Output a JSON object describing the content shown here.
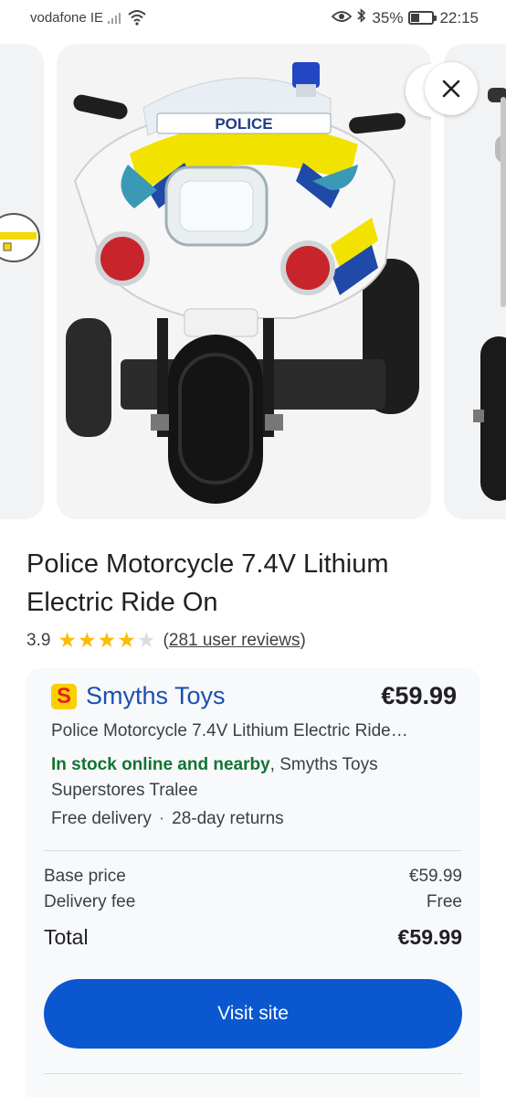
{
  "status_bar": {
    "carrier": "vodafone IE",
    "battery": "35%",
    "time": "22:15"
  },
  "carousel": {
    "main_image_text": "POLICE",
    "more_icon": "more-vert-icon",
    "close_icon": "close-icon"
  },
  "product": {
    "title": "Police Motorcycle 7.4V Lithium Electric Ride On",
    "rating": "3.9",
    "stars": 3.9,
    "reviews": "281 user reviews"
  },
  "seller": {
    "logo_letter": "S",
    "name": "Smyths Toys",
    "price": "€59.99",
    "listing_title": "Police Motorcycle 7.4V Lithium Electric Ride…",
    "stock_status": "In stock online and nearby",
    "stock_location": ", Smyths Toys Superstores Tralee",
    "delivery": "Free delivery",
    "returns": "28-day returns"
  },
  "price_breakdown": {
    "base_label": "Base price",
    "base_value": "€59.99",
    "delivery_label": "Delivery fee",
    "delivery_value": "Free",
    "total_label": "Total",
    "total_value": "€59.99"
  },
  "actions": {
    "visit_site": "Visit site"
  },
  "colors": {
    "accent_blue": "#0b57d0",
    "seller_link": "#1a4fb3",
    "in_stock_green": "#137333",
    "star_yellow": "#fbbc04"
  }
}
